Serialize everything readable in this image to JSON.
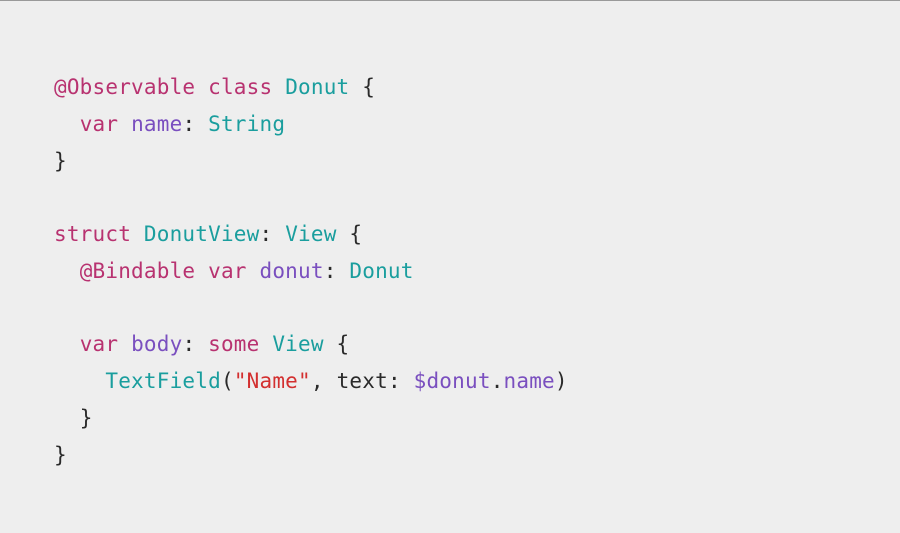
{
  "code": {
    "line1": {
      "attr": "@Observable",
      "kw_class": "class",
      "type": "Donut",
      "brace": " {"
    },
    "line2": {
      "indent": "  ",
      "kw_var": "var",
      "ident": "name",
      "colon": ": ",
      "type": "String"
    },
    "line3": {
      "brace": "}"
    },
    "line4": {
      "blank": ""
    },
    "line5": {
      "kw_struct": "struct",
      "type1": "DonutView",
      "colon": ": ",
      "type2": "View",
      "brace": " {"
    },
    "line6": {
      "indent": "  ",
      "attr": "@Bindable",
      "kw_var": "var",
      "ident": "donut",
      "colon": ": ",
      "type": "Donut"
    },
    "line7": {
      "blank": ""
    },
    "line8": {
      "indent": "  ",
      "kw_var": "var",
      "ident": "body",
      "colon": ": ",
      "kw_some": "some",
      "type": "View",
      "brace": " {"
    },
    "line9": {
      "indent": "    ",
      "func": "TextField",
      "open": "(",
      "string": "\"Name\"",
      "comma": ", ",
      "label": "text",
      "lcolon": ": ",
      "dollar": "$donut",
      "dot": ".",
      "member": "name",
      "close": ")"
    },
    "line10": {
      "indent": "  ",
      "brace": "}"
    },
    "line11": {
      "brace": "}"
    }
  }
}
